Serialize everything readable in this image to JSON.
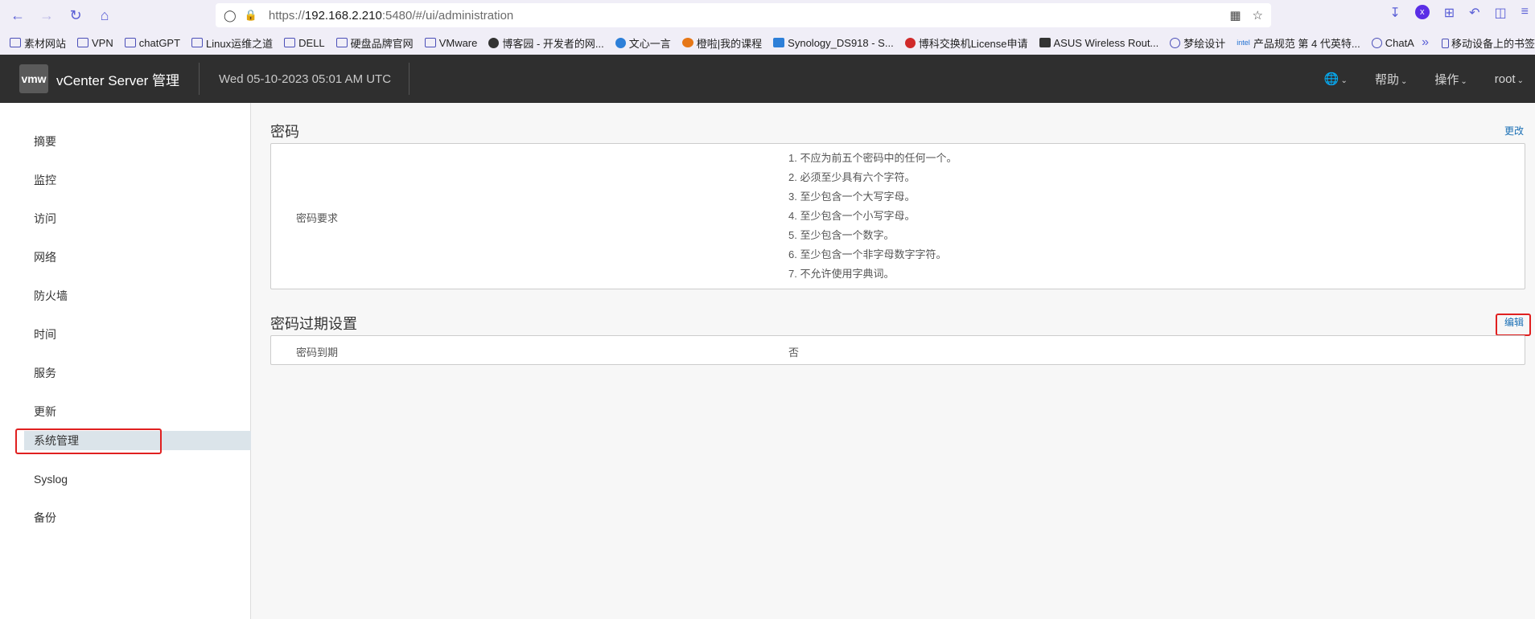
{
  "browser": {
    "url_scheme": "https://",
    "url_host": "192.168.2.210",
    "url_rest": ":5480/#/ui/administration"
  },
  "bookmarks": [
    {
      "label": "素材网站",
      "icon": "folder-icon"
    },
    {
      "label": "VPN",
      "icon": "folder-icon"
    },
    {
      "label": "chatGPT",
      "icon": "folder-icon"
    },
    {
      "label": "Linux运维之道",
      "icon": "folder-icon"
    },
    {
      "label": "DELL",
      "icon": "folder-icon"
    },
    {
      "label": "硬盘品牌官网",
      "icon": "folder-icon"
    },
    {
      "label": "VMware",
      "icon": "folder-icon"
    },
    {
      "label": "博客园 - 开发者的网...",
      "icon": "cnblogs-icon"
    },
    {
      "label": "文心一言",
      "icon": "wenxin-icon"
    },
    {
      "label": "橙啦|我的课程",
      "icon": "chengla-icon"
    },
    {
      "label": "Synology_DS918 - S...",
      "icon": "synology-icon"
    },
    {
      "label": "博科交换机License申请",
      "icon": "broadcom-icon"
    },
    {
      "label": "ASUS Wireless Rout...",
      "icon": "asus-icon"
    },
    {
      "label": "梦绘设计",
      "icon": "globe-icon"
    },
    {
      "label": "产品规范 第 4 代英特...",
      "icon": "intel-icon"
    },
    {
      "label": "ChatAI",
      "icon": "globe-icon"
    }
  ],
  "bookmarks_more_label": "移动设备上的书签",
  "header": {
    "logo_text": "vmw",
    "title": "vCenter Server 管理",
    "datetime": "Wed 05-10-2023 05:01 AM UTC",
    "menus": [
      "帮助",
      "操作",
      "root"
    ]
  },
  "sidebar": {
    "items": [
      "摘要",
      "监控",
      "访问",
      "网络",
      "防火墙",
      "时间",
      "服务",
      "更新",
      "系统管理",
      "Syslog",
      "备份"
    ],
    "active_index": 8
  },
  "password_section": {
    "title": "密码",
    "action": "更改",
    "requirements_label": "密码要求",
    "requirements": [
      "1. 不应为前五个密码中的任何一个。",
      "2. 必须至少具有六个字符。",
      "3. 至少包含一个大写字母。",
      "4. 至少包含一个小写字母。",
      "5. 至少包含一个数字。",
      "6. 至少包含一个非字母数字字符。",
      "7. 不允许使用字典词。"
    ]
  },
  "expiry_section": {
    "title": "密码过期设置",
    "action": "编辑",
    "row_label": "密码到期",
    "row_value": "否"
  },
  "colors": {
    "header_bg": "#2f2f2f",
    "link": "#1a6fb5",
    "highlight": "#e02020",
    "active_bg": "#dbe4ea"
  }
}
